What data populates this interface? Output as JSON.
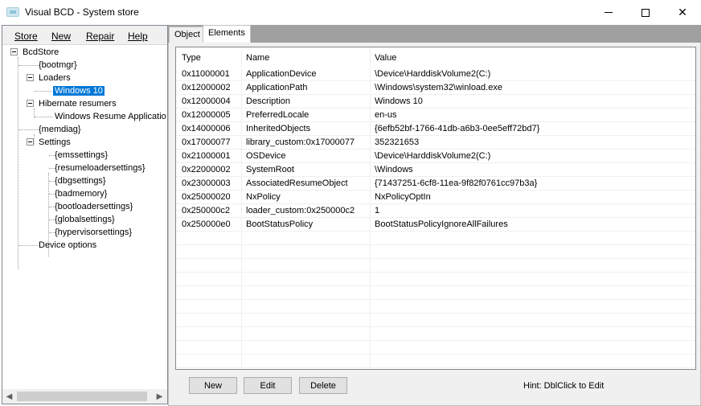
{
  "window": {
    "title": "Visual BCD - System store"
  },
  "menu": {
    "store": "Store",
    "new": "New",
    "repair": "Repair",
    "help": "Help"
  },
  "tree": {
    "root": "BcdStore",
    "bootmgr": "{bootmgr}",
    "loaders": "Loaders",
    "windows10": "Windows 10",
    "hibernate": "Hibernate resumers",
    "winresume": "Windows Resume Applicatio",
    "memdiag": "{memdiag}",
    "settings": "Settings",
    "settings_children": [
      "{emssettings}",
      "{resumeloadersettings}",
      "{dbgsettings}",
      "{badmemory}",
      "{bootloadersettings}",
      "{globalsettings}",
      "{hypervisorsettings}"
    ],
    "device_options": "Device options"
  },
  "tabs": {
    "object": "Object",
    "elements": "Elements"
  },
  "grid": {
    "headers": {
      "type": "Type",
      "name": "Name",
      "value": "Value"
    },
    "rows": [
      {
        "type": "0x11000001",
        "name": "ApplicationDevice",
        "value": "\\Device\\HarddiskVolume2(C:)"
      },
      {
        "type": "0x12000002",
        "name": "ApplicationPath",
        "value": "\\Windows\\system32\\winload.exe"
      },
      {
        "type": "0x12000004",
        "name": "Description",
        "value": "Windows 10"
      },
      {
        "type": "0x12000005",
        "name": "PreferredLocale",
        "value": "en-us"
      },
      {
        "type": "0x14000006",
        "name": "InheritedObjects",
        "value": "{6efb52bf-1766-41db-a6b3-0ee5eff72bd7}"
      },
      {
        "type": "0x17000077",
        "name": "library_custom:0x17000077",
        "value": "352321653"
      },
      {
        "type": "0x21000001",
        "name": "OSDevice",
        "value": "\\Device\\HarddiskVolume2(C:)"
      },
      {
        "type": "0x22000002",
        "name": "SystemRoot",
        "value": "\\Windows"
      },
      {
        "type": "0x23000003",
        "name": "AssociatedResumeObject",
        "value": "{71437251-6cf8-11ea-9f82f0761cc97b3a}"
      },
      {
        "type": "0x25000020",
        "name": "NxPolicy",
        "value": "NxPolicyOptIn"
      },
      {
        "type": "0x250000c2",
        "name": "loader_custom:0x250000c2",
        "value": "1"
      },
      {
        "type": "0x250000e0",
        "name": "BootStatusPolicy",
        "value": "BootStatusPolicyIgnoreAllFailures"
      }
    ]
  },
  "buttons": {
    "new": "New",
    "edit": "Edit",
    "delete": "Delete"
  },
  "hint": "Hint: DblClick to Edit",
  "colors": {
    "selection": "#0078d7",
    "tab_strip": "#a0a0a0",
    "panel": "#f0f0f0"
  }
}
